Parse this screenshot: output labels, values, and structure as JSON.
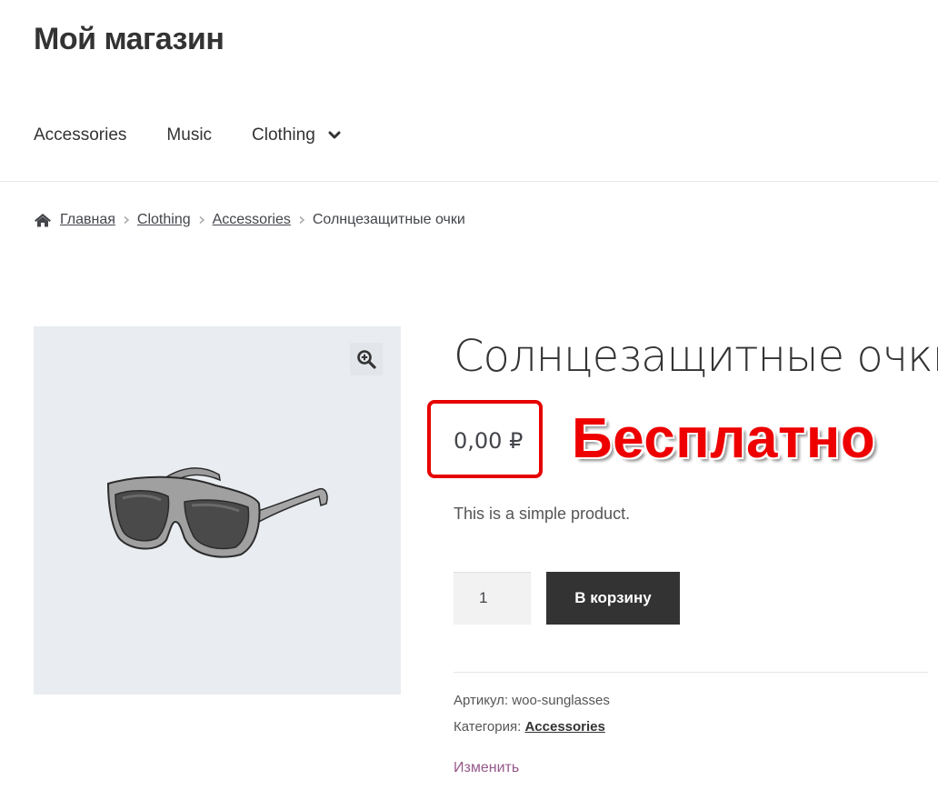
{
  "site": {
    "title": "Мой магазин"
  },
  "nav": {
    "items": [
      {
        "label": "Accessories"
      },
      {
        "label": "Music"
      },
      {
        "label": "Clothing",
        "has_submenu": true
      }
    ]
  },
  "breadcrumb": {
    "home": "Главная",
    "items": [
      "Clothing",
      "Accessories"
    ],
    "current": "Солнцезащитные очки"
  },
  "product": {
    "title": "Солнцезащитные очки",
    "price": "0,00 ₽",
    "annotation": "Бесплатно",
    "short_description": "This is a simple product.",
    "quantity": "1",
    "add_to_cart_label": "В корзину",
    "sku_label": "Артикул:",
    "sku_value": "woo-sunglasses",
    "category_label": "Категория:",
    "category_value": "Accessories",
    "edit_label": "Изменить",
    "image_icon": "sunglasses",
    "zoom_icon": "zoom-in-icon"
  },
  "colors": {
    "accent": "#96588a",
    "annotation_red": "#ee0000",
    "button_bg": "#333333",
    "image_bg": "#e9edf1"
  }
}
